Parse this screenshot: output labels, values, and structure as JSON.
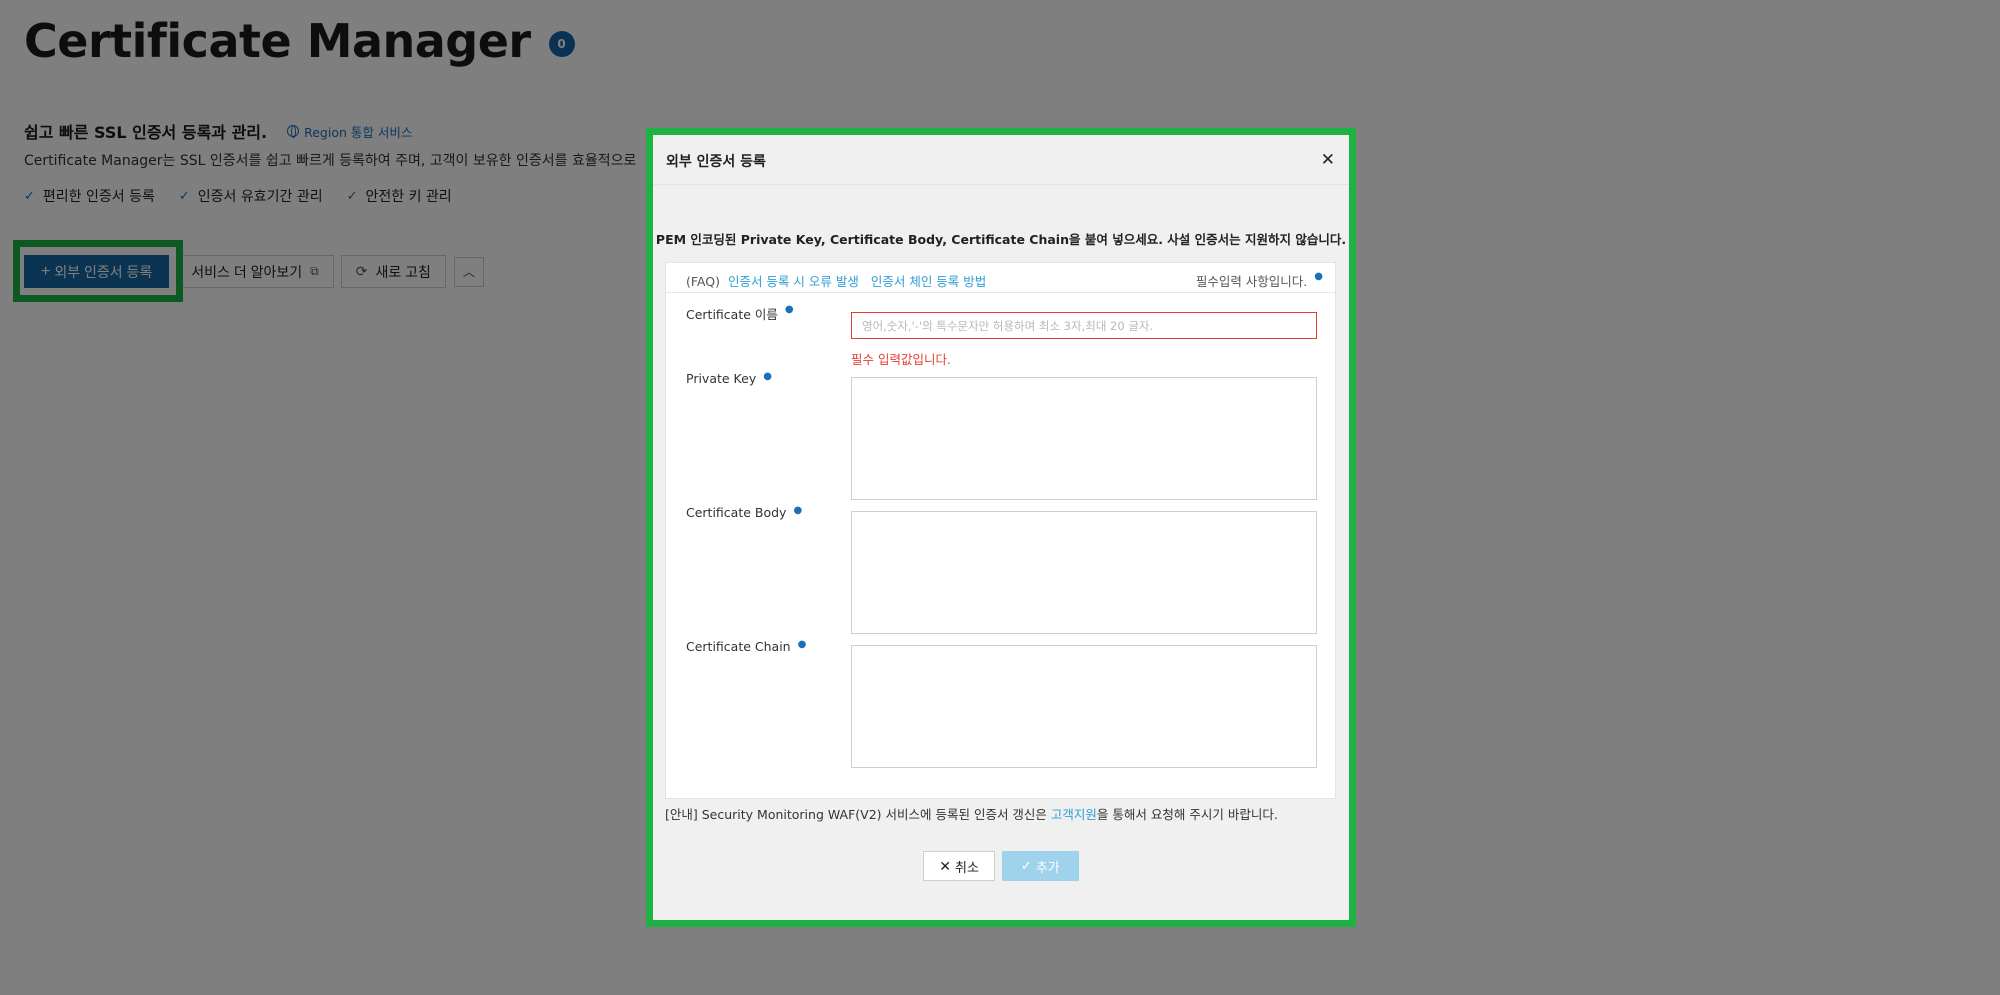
{
  "page": {
    "title": "Certificate Manager",
    "count": "0",
    "subtitle": "쉽고 빠른 SSL 인증서 등록과 관리.",
    "region_link": "Region 통합 서비스",
    "description": "Certificate Manager는 SSL 인증서를 쉽고 빠르게 등록하여 주며, 고객이 보유한 인증서를 효율적으로",
    "features": [
      "편리한 인증서 등록",
      "인증서 유효기간 관리",
      "안전한 키 관리"
    ]
  },
  "toolbar": {
    "register_label": "외부 인증서 등록",
    "learn_more_label": "서비스 더 알아보기",
    "refresh_label": "새로 고침"
  },
  "modal": {
    "title": "외부 인증서 등록",
    "notice": "PEM 인코딩된 Private Key, Certificate Body, Certificate Chain을 붙여 넣으세요. 사설 인증서는 지원하지 않습니다.",
    "faq_prefix": "(FAQ)",
    "faq_link1": "인증서 등록 시 오류 발생",
    "faq_link2": "인증서 체인 등록 방법",
    "required_note": "필수입력 사항입니다.",
    "fields": {
      "name_label": "Certificate 이름",
      "name_placeholder": "영어,숫자,'-'의 특수문자만 허용하며 최소 3자,최대 20 글자.",
      "name_error": "필수 입력값입니다.",
      "private_key_label": "Private Key",
      "body_label": "Certificate Body",
      "chain_label": "Certificate Chain"
    },
    "info_prefix": "[안내] Security Monitoring WAF(V2) 서비스에 등록된 인증서 갱신은 ",
    "info_link": "고객지원",
    "info_suffix": "을 통해서 요청해 주시기 바랍니다.",
    "cancel_label": "취소",
    "add_label": "추가"
  },
  "colors": {
    "primary": "#1469a5",
    "link": "#2f9fd8",
    "error": "#e4402f",
    "highlight": "#1db342",
    "add_disabled": "#9fd3ec"
  }
}
